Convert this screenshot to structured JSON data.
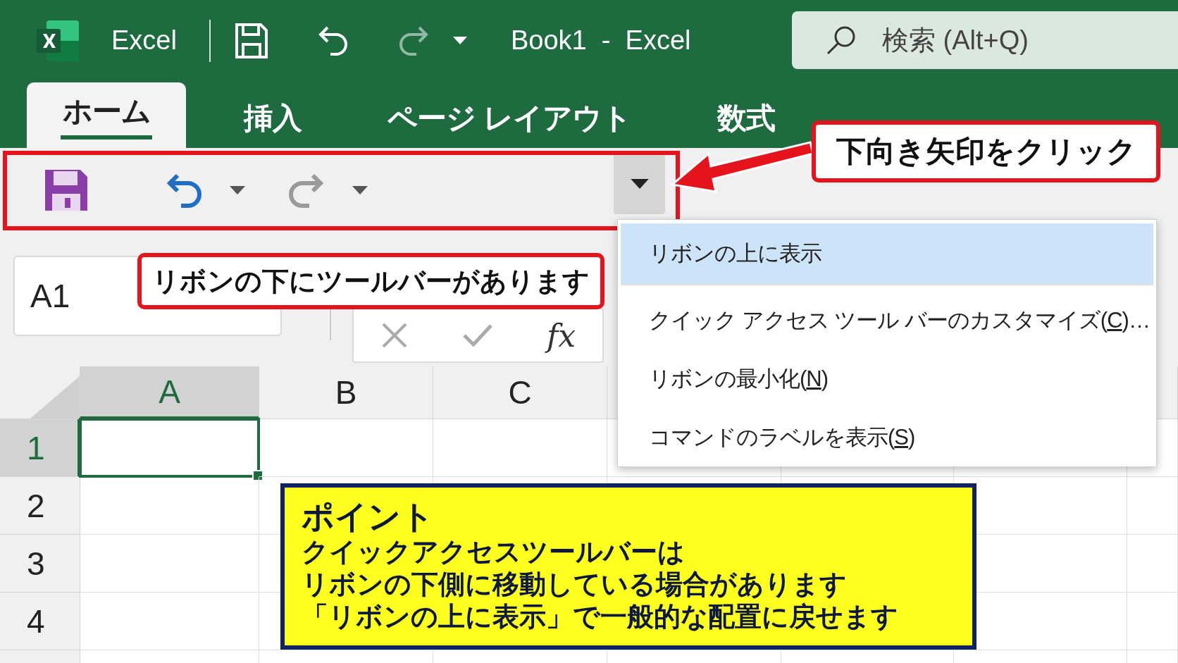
{
  "title_bar": {
    "app_name": "Excel",
    "document_title": "Book1  -  Excel",
    "search": {
      "placeholder": "検索 (Alt+Q)"
    }
  },
  "ribbon_tabs": [
    {
      "label": "ホーム",
      "selected": true
    },
    {
      "label": "挿入",
      "selected": false
    },
    {
      "label": "ページ レイアウト",
      "selected": false
    },
    {
      "label": "数式",
      "selected": false
    }
  ],
  "name_box": {
    "value": "A1"
  },
  "formula_bar": {
    "function_label": "fx"
  },
  "columns": [
    {
      "label": "A",
      "selected": true
    },
    {
      "label": "B",
      "selected": false
    },
    {
      "label": "C",
      "selected": false
    }
  ],
  "rows": [
    {
      "label": "1",
      "selected": true
    },
    {
      "label": "2",
      "selected": false
    },
    {
      "label": "3",
      "selected": false
    },
    {
      "label": "4",
      "selected": false
    }
  ],
  "dropdown_menu": {
    "items": [
      {
        "text_before": "リボンの上に表示",
        "selected": true
      },
      {
        "text_before": "クイック アクセス ツール バーのカスタマイズ(",
        "access_key": "C",
        "text_after": ")…",
        "selected": false
      },
      {
        "text_before": "リボンの最小化(",
        "access_key": "N",
        "text_after": ")",
        "selected": false
      },
      {
        "text_before": "コマンドのラベルを表示(",
        "access_key": "S",
        "text_after": ")",
        "selected": false
      }
    ]
  },
  "callouts": [
    {
      "kind": "arrow",
      "text": "下向き矢印をクリック"
    },
    {
      "kind": "plain",
      "text": "リボンの下にツールバーがあります"
    }
  ],
  "note": {
    "title": "ポイント",
    "lines": [
      "クイックアクセスツールバーは",
      "リボンの下側に移動している場合があります",
      "「リボンの上に表示」で一般的な配置に戻せます"
    ]
  }
}
